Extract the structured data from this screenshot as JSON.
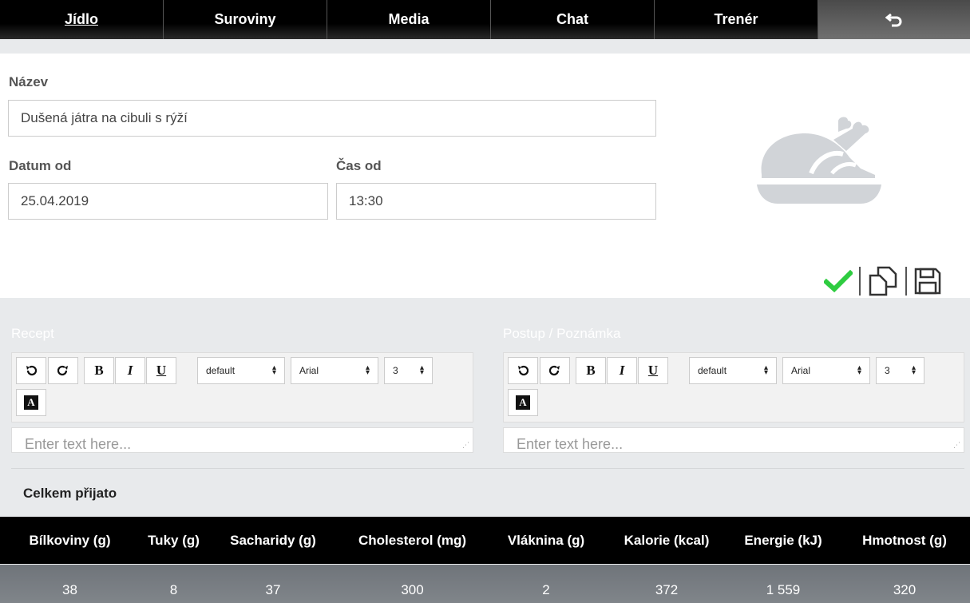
{
  "nav": {
    "tabs": [
      {
        "label": "Jídlo",
        "active": true
      },
      {
        "label": "Suroviny"
      },
      {
        "label": "Media"
      },
      {
        "label": "Chat"
      },
      {
        "label": "Trenér"
      }
    ],
    "back_icon": "undo-arrow-icon"
  },
  "form": {
    "name_label": "Název",
    "name_value": "Dušená játra na cibuli s rýží",
    "date_label": "Datum od",
    "date_value": "25.04.2019",
    "time_label": "Čas od",
    "time_value": "13:30",
    "image_icon": "roast-chicken-icon"
  },
  "actions": {
    "confirm_icon": "check-icon",
    "copy_icon": "copy-icon",
    "save_icon": "save-icon",
    "confirm_color": "#2ecc40"
  },
  "editors": [
    {
      "title": "Recept",
      "placeholder": "Enter text here...",
      "format": "default",
      "font": "Arial",
      "size": "3"
    },
    {
      "title": "Postup / Poznámka",
      "placeholder": "Enter text here...",
      "format": "default",
      "font": "Arial",
      "size": "3"
    }
  ],
  "toolbar_buttons": {
    "bold": "B",
    "italic": "I",
    "underline": "U",
    "color": "A"
  },
  "totals": {
    "label": "Celkem přijato",
    "columns": [
      "Bílkoviny (g)",
      "Tuky (g)",
      "Sacharidy (g)",
      "Cholesterol (mg)",
      "Vláknina (g)",
      "Kalorie (kcal)",
      "Energie (kJ)",
      "Hmotnost (g)"
    ],
    "values": [
      "38",
      "8",
      "37",
      "300",
      "2",
      "372",
      "1 559",
      "320"
    ]
  }
}
